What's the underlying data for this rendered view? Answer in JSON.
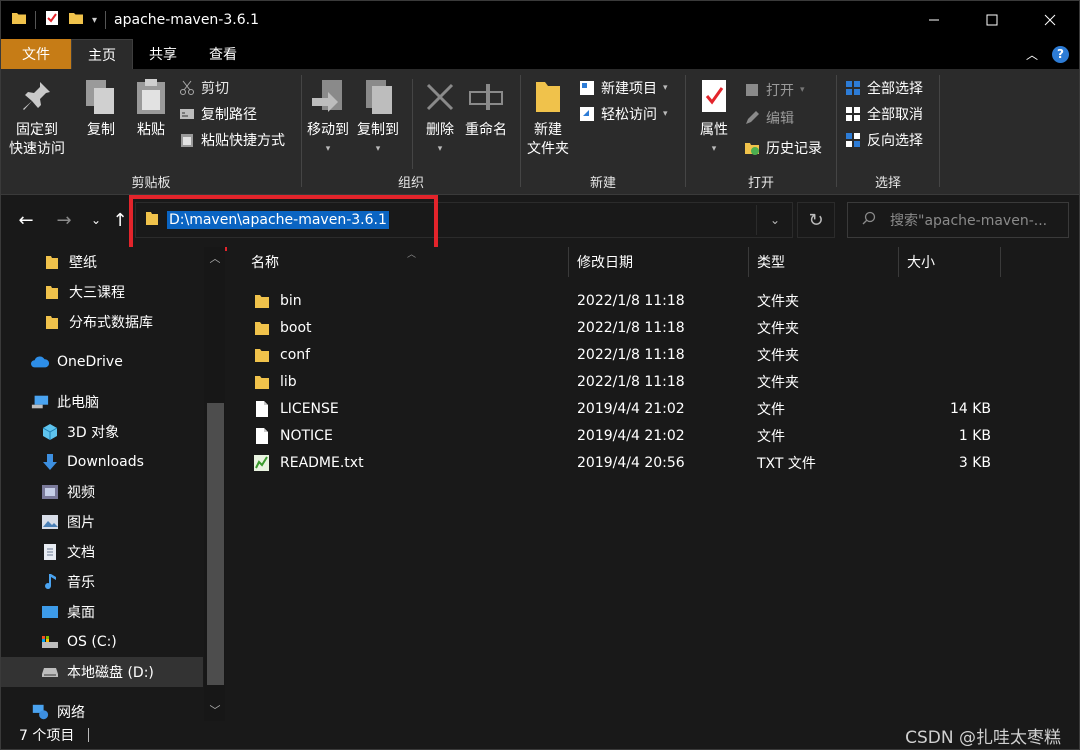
{
  "window": {
    "title": "apache-maven-3.6.1",
    "minimize_icon": "minimize-icon",
    "maximize_icon": "maximize-icon",
    "close_icon": "close-icon"
  },
  "ribbon_tabs": {
    "file": "文件",
    "home": "主页",
    "share": "共享",
    "view": "查看"
  },
  "ribbon": {
    "clipboard": {
      "label": "剪贴板",
      "pin": [
        "固定到",
        "快速访问"
      ],
      "copy": "复制",
      "paste": "粘贴",
      "cut": "剪切",
      "copy_path": "复制路径",
      "paste_shortcut": "粘贴快捷方式"
    },
    "organize": {
      "label": "组织",
      "move_to": "移动到",
      "copy_to": "复制到",
      "delete": "删除",
      "rename": "重命名"
    },
    "new": {
      "label": "新建",
      "new_folder": [
        "新建",
        "文件夹"
      ],
      "new_item": "新建项目",
      "easy_access": "轻松访问"
    },
    "open": {
      "label": "打开",
      "properties": "属性",
      "open": "打开",
      "edit": "编辑",
      "history": "历史记录"
    },
    "select": {
      "label": "选择",
      "select_all": "全部选择",
      "select_none": "全部取消",
      "invert": "反向选择"
    }
  },
  "address": {
    "path": "D:\\maven\\apache-maven-3.6.1",
    "search_placeholder": "搜索\"apache-maven-..."
  },
  "nav_pane": {
    "items": [
      {
        "label": "壁纸",
        "icon": "folder-icon"
      },
      {
        "label": "大三课程",
        "icon": "folder-icon"
      },
      {
        "label": "分布式数据库",
        "icon": "folder-icon"
      },
      {
        "label": "OneDrive",
        "icon": "onedrive-icon"
      },
      {
        "label": "此电脑",
        "icon": "this-pc-icon"
      },
      {
        "label": "3D 对象",
        "icon": "3d-objects-icon"
      },
      {
        "label": "Downloads",
        "icon": "downloads-icon"
      },
      {
        "label": "视频",
        "icon": "videos-icon"
      },
      {
        "label": "图片",
        "icon": "pictures-icon"
      },
      {
        "label": "文档",
        "icon": "documents-icon"
      },
      {
        "label": "音乐",
        "icon": "music-icon"
      },
      {
        "label": "桌面",
        "icon": "desktop-icon"
      },
      {
        "label": "OS (C:)",
        "icon": "system-drive-icon"
      },
      {
        "label": "本地磁盘 (D:)",
        "icon": "local-drive-icon"
      },
      {
        "label": "网络",
        "icon": "network-icon"
      }
    ]
  },
  "file_list": {
    "columns": {
      "name": "名称",
      "modified": "修改日期",
      "type": "类型",
      "size": "大小"
    },
    "rows": [
      {
        "name": "bin",
        "modified": "2022/1/8 11:18",
        "type": "文件夹",
        "size": "",
        "icon": "folder-icon"
      },
      {
        "name": "boot",
        "modified": "2022/1/8 11:18",
        "type": "文件夹",
        "size": "",
        "icon": "folder-icon"
      },
      {
        "name": "conf",
        "modified": "2022/1/8 11:18",
        "type": "文件夹",
        "size": "",
        "icon": "folder-icon"
      },
      {
        "name": "lib",
        "modified": "2022/1/8 11:18",
        "type": "文件夹",
        "size": "",
        "icon": "folder-icon"
      },
      {
        "name": "LICENSE",
        "modified": "2019/4/4 21:02",
        "type": "文件",
        "size": "14 KB",
        "icon": "file-icon"
      },
      {
        "name": "NOTICE",
        "modified": "2019/4/4 21:02",
        "type": "文件",
        "size": "1 KB",
        "icon": "file-icon"
      },
      {
        "name": "README.txt",
        "modified": "2019/4/4 20:56",
        "type": "TXT 文件",
        "size": "3 KB",
        "icon": "text-file-icon"
      }
    ]
  },
  "status": {
    "item_count": "7 个项目"
  },
  "watermark": "CSDN @扎哇太枣糕",
  "colors": {
    "accent_file_tab": "#c67c16",
    "selection_blue": "#0a64c2",
    "highlight_red": "#e3242b",
    "folder_yellow": "#f0c24b"
  }
}
